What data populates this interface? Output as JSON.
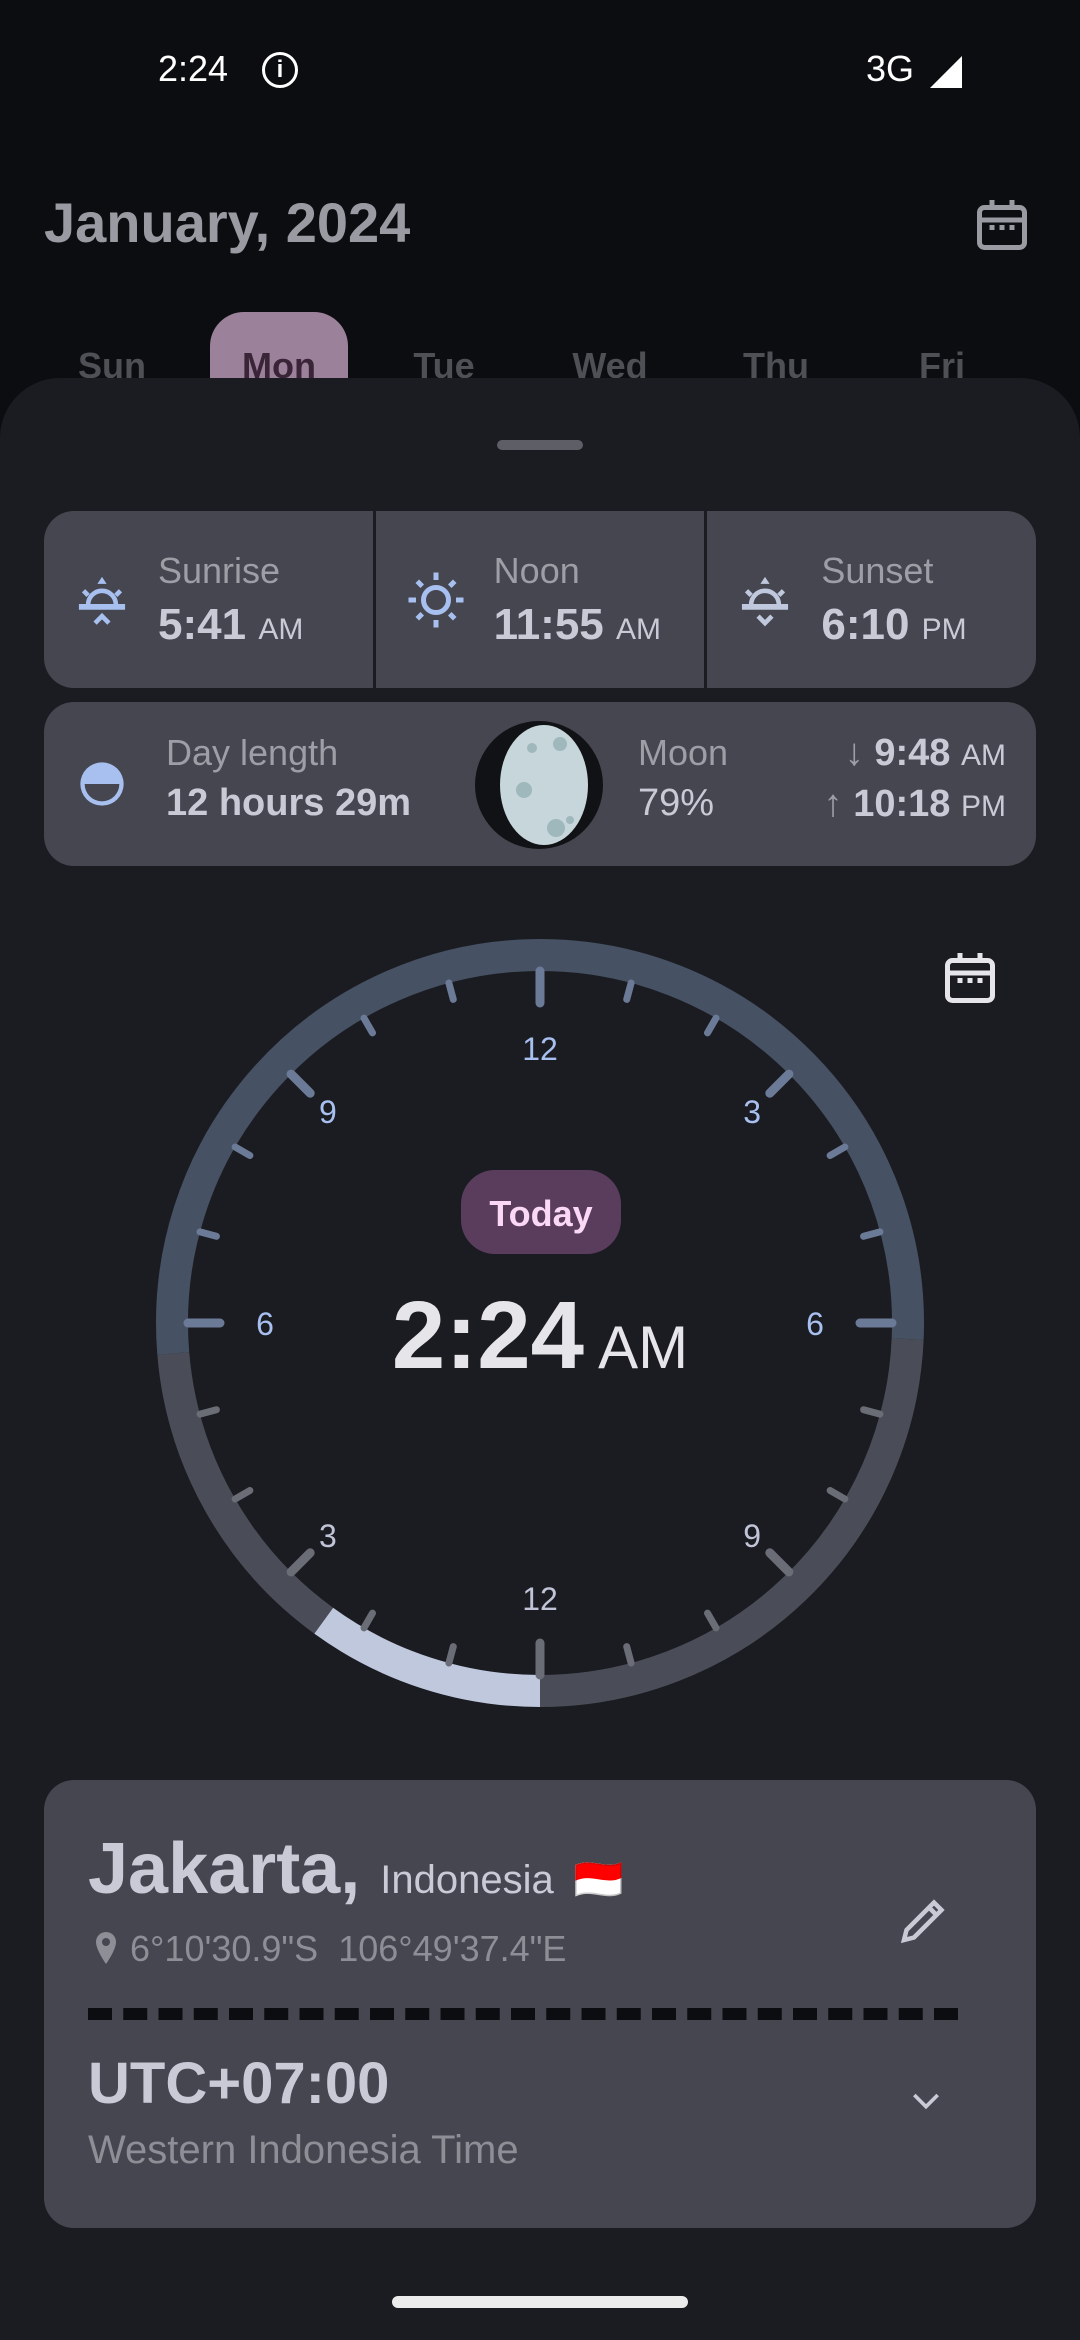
{
  "status_bar": {
    "time": "2:24",
    "network": "3G",
    "icons": [
      "info-icon",
      "signal-icon"
    ]
  },
  "header": {
    "title": "January, 2024",
    "calendar_icon": "calendar-icon"
  },
  "week": {
    "days": [
      "Sun",
      "Mon",
      "Tue",
      "Wed",
      "Thu",
      "Fri"
    ],
    "selected": "Mon"
  },
  "sun": {
    "sunrise": {
      "label": "Sunrise",
      "time": "5:41",
      "period": "AM"
    },
    "noon": {
      "label": "Noon",
      "time": "11:55",
      "period": "AM"
    },
    "sunset": {
      "label": "Sunset",
      "time": "6:10",
      "period": "PM"
    }
  },
  "day_length": {
    "label": "Day length",
    "value": "12 hours 29m"
  },
  "moon": {
    "label": "Moon",
    "illumination": "79%",
    "set_time": "9:48",
    "set_period": "AM",
    "rise_time": "10:18",
    "rise_period": "PM"
  },
  "clock": {
    "badge": "Today",
    "time": "2:24",
    "period": "AM",
    "top_labels": [
      "12",
      "3",
      "6",
      "9"
    ],
    "bottom_labels": [
      "6",
      "9",
      "12",
      "3"
    ],
    "current_hours": 2.4,
    "sunrise_hours": 5.683,
    "sunset_hours": 18.167,
    "colors": {
      "day": "#465163",
      "night": "#4a4d57",
      "elapsed": "#c0c8de",
      "day_label": "#a8c0f0",
      "night_label": "#c0c4d6",
      "badge_bg": "#5a3d5c",
      "badge_text": "#fbd9f6"
    }
  },
  "location": {
    "city": "Jakarta,",
    "country": "Indonesia",
    "flag": "🇮🇩",
    "lat": "6°10'30.9\"S",
    "lon": "106°49'37.4\"E",
    "utc": "UTC+07:00",
    "tz_name": "Western Indonesia Time"
  }
}
